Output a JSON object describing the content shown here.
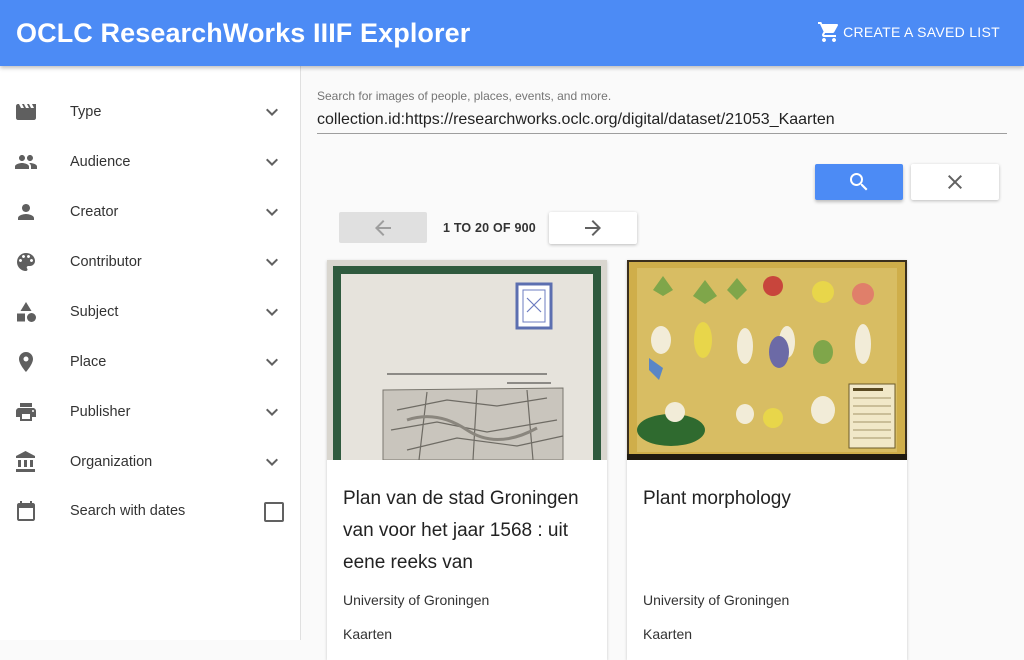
{
  "app": {
    "title": "OCLC ResearchWorks IIIF Explorer",
    "saved_list_label": "CREATE A SAVED LIST",
    "cart_icon": "shopping-cart-icon",
    "brand_color": "#4c8bf5"
  },
  "sidebar": {
    "facets": [
      {
        "label": "Type",
        "icon": "movie-icon"
      },
      {
        "label": "Audience",
        "icon": "people-icon"
      },
      {
        "label": "Creator",
        "icon": "person-icon"
      },
      {
        "label": "Contributor",
        "icon": "palette-icon"
      },
      {
        "label": "Subject",
        "icon": "category-icon"
      },
      {
        "label": "Place",
        "icon": "place-icon"
      },
      {
        "label": "Publisher",
        "icon": "print-icon"
      },
      {
        "label": "Organization",
        "icon": "account-balance-icon"
      }
    ],
    "dates": {
      "label": "Search with dates",
      "icon": "calendar-icon",
      "checked": false
    }
  },
  "search": {
    "placeholder": "Search for images of people, places, events, and more.",
    "value": "collection.id:https://researchworks.oclc.org/digital/dataset/21053_Kaarten",
    "search_icon": "search-icon",
    "clear_icon": "close-icon"
  },
  "pager": {
    "text": "1 TO 20 OF 900",
    "prev_icon": "arrow-back-icon",
    "next_icon": "arrow-forward-icon"
  },
  "results": [
    {
      "title": "Plan van de stad Groningen van voor het jaar 1568 : uit eene reeks van",
      "institution": "University of Groningen",
      "collection": "Kaarten",
      "thumb": "map-thumbnail"
    },
    {
      "title": "Plant morphology",
      "institution": "University of Groningen",
      "collection": "Kaarten",
      "thumb": "botanical-chart-thumbnail"
    }
  ]
}
